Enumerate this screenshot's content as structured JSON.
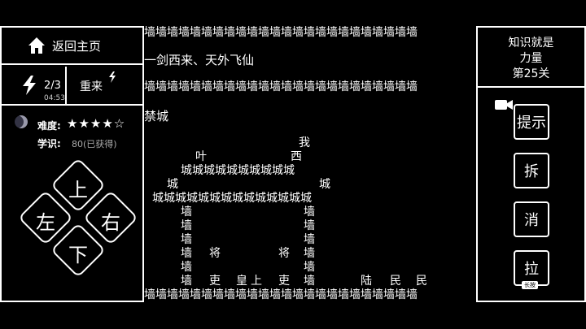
{
  "left_panel": {
    "home_label": "返回主页",
    "energy_count": "2/3",
    "energy_timer": "04:53",
    "restart_label": "重来",
    "difficulty_label": "难度:",
    "difficulty_stars": "★★★★☆",
    "knowledge_label": "学识:",
    "knowledge_value": "80(已获得)"
  },
  "dpad": {
    "up": "上",
    "left": "左",
    "right": "右",
    "down": "下"
  },
  "board": {
    "wall_row": "墙墙墙墙墙墙墙墙墙墙墙墙墙墙墙墙墙墙墙墙墙墙墙墙",
    "poem": "一剑西来、天外飞仙",
    "forbidden_city_frag": "禁城",
    "player": "我",
    "ye": "叶",
    "xi": "西",
    "city_row1": "城城城城城城城城城城",
    "city_left": "城",
    "city_right": "城",
    "city_row2": "城城城城城城城城城城城城城城",
    "wall_char": "墙",
    "jiang": "将",
    "li": "吏",
    "huang": "皇",
    "shang": "上",
    "lu": "陆",
    "min": "民"
  },
  "right_panel": {
    "title_line1": "知识就是",
    "title_line2": "力量",
    "level": "第25关",
    "hint_label": "提示",
    "split_label": "拆",
    "erase_label": "消",
    "pull_label": "拉",
    "long_press_tag": "长按"
  }
}
